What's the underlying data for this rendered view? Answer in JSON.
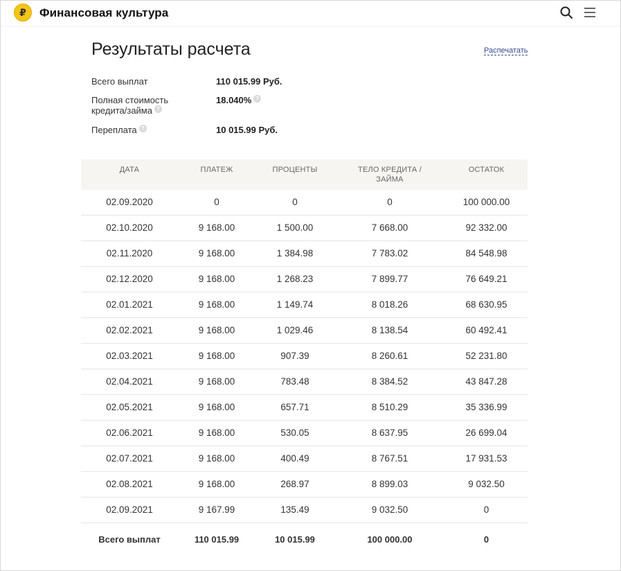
{
  "header": {
    "logo_glyph": "₽",
    "brand": "Финансовая культура",
    "search_icon": "search-icon",
    "menu_icon": "hamburger-menu-icon"
  },
  "page": {
    "title": "Результаты расчета",
    "print_link": "Распечатать"
  },
  "summary": {
    "total_label": "Всего выплат",
    "total_value": "110 015.99 Руб.",
    "cost_label": "Полная стоимость кредита/займа",
    "cost_value": "18.040%",
    "overpay_label": "Переплата",
    "overpay_value": "10 015.99 Руб."
  },
  "table": {
    "headers": [
      "ДАТА",
      "ПЛАТЕЖ",
      "ПРОЦЕНТЫ",
      "ТЕЛО КРЕДИТА / ЗАЙМА",
      "ОСТАТОК"
    ],
    "rows": [
      [
        "02.09.2020",
        "0",
        "0",
        "0",
        "100 000.00"
      ],
      [
        "02.10.2020",
        "9 168.00",
        "1 500.00",
        "7 668.00",
        "92 332.00"
      ],
      [
        "02.11.2020",
        "9 168.00",
        "1 384.98",
        "7 783.02",
        "84 548.98"
      ],
      [
        "02.12.2020",
        "9 168.00",
        "1 268.23",
        "7 899.77",
        "76 649.21"
      ],
      [
        "02.01.2021",
        "9 168.00",
        "1 149.74",
        "8 018.26",
        "68 630.95"
      ],
      [
        "02.02.2021",
        "9 168.00",
        "1 029.46",
        "8 138.54",
        "60 492.41"
      ],
      [
        "02.03.2021",
        "9 168.00",
        "907.39",
        "8 260.61",
        "52 231.80"
      ],
      [
        "02.04.2021",
        "9 168.00",
        "783.48",
        "8 384.52",
        "43 847.28"
      ],
      [
        "02.05.2021",
        "9 168.00",
        "657.71",
        "8 510.29",
        "35 336.99"
      ],
      [
        "02.06.2021",
        "9 168.00",
        "530.05",
        "8 637.95",
        "26 699.04"
      ],
      [
        "02.07.2021",
        "9 168.00",
        "400.49",
        "8 767.51",
        "17 931.53"
      ],
      [
        "02.08.2021",
        "9 168.00",
        "268.97",
        "8 899.03",
        "9 032.50"
      ],
      [
        "02.09.2021",
        "9 167.99",
        "135.49",
        "9 032.50",
        "0"
      ]
    ],
    "totals": [
      "Всего выплат",
      "110 015.99",
      "10 015.99",
      "100 000.00",
      "0"
    ]
  },
  "colors": {
    "logo_fill": "#f5c518",
    "link": "#3a4a8c",
    "table_header_bg": "#f6f5f1"
  }
}
